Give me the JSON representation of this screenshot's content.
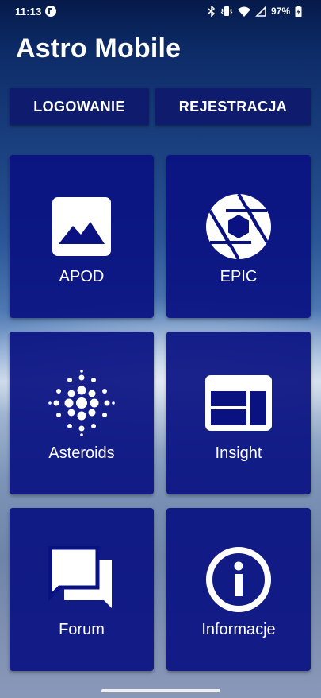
{
  "status_bar": {
    "time": "11:13",
    "battery_percent": "97%"
  },
  "app": {
    "title": "Astro Mobile"
  },
  "auth": {
    "login_label": "LOGOWANIE",
    "register_label": "REJESTRACJA"
  },
  "tiles": [
    {
      "label": "APOD",
      "icon": "image-icon"
    },
    {
      "label": "EPIC",
      "icon": "camera-aperture-icon"
    },
    {
      "label": "Asteroids",
      "icon": "dots-burst-icon"
    },
    {
      "label": "Insight",
      "icon": "dashboard-icon"
    },
    {
      "label": "Forum",
      "icon": "chat-bubbles-icon"
    },
    {
      "label": "Informacje",
      "icon": "info-icon"
    }
  ],
  "colors": {
    "tile_background": "#0a1282",
    "button_background": "#0f1c6e",
    "text": "#ffffff"
  }
}
